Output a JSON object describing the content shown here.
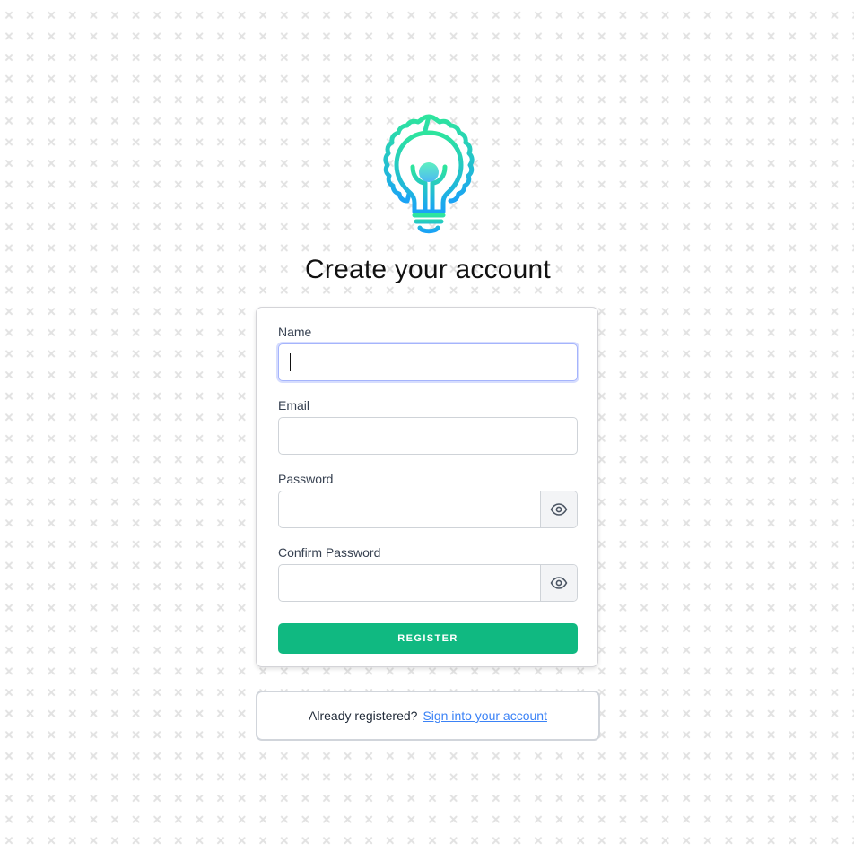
{
  "header": {
    "title": "Create your account",
    "logo_icon": "lightbulb-icon"
  },
  "form": {
    "name": {
      "label": "Name",
      "value": ""
    },
    "email": {
      "label": "Email",
      "value": ""
    },
    "password": {
      "label": "Password",
      "value": "",
      "toggle_icon": "eye-icon"
    },
    "confirm_password": {
      "label": "Confirm Password",
      "value": "",
      "toggle_icon": "eye-icon"
    },
    "submit_label": "REGISTER"
  },
  "signin": {
    "prompt": "Already registered?",
    "link_label": "Sign into your account"
  },
  "colors": {
    "accent": "#10b981",
    "link": "#3b82f6",
    "focus_ring": "#a5b4fc",
    "logo_gradient_top": "#2ee59d",
    "logo_gradient_bottom": "#1aa3f5",
    "pattern": "#e3e3e3"
  }
}
